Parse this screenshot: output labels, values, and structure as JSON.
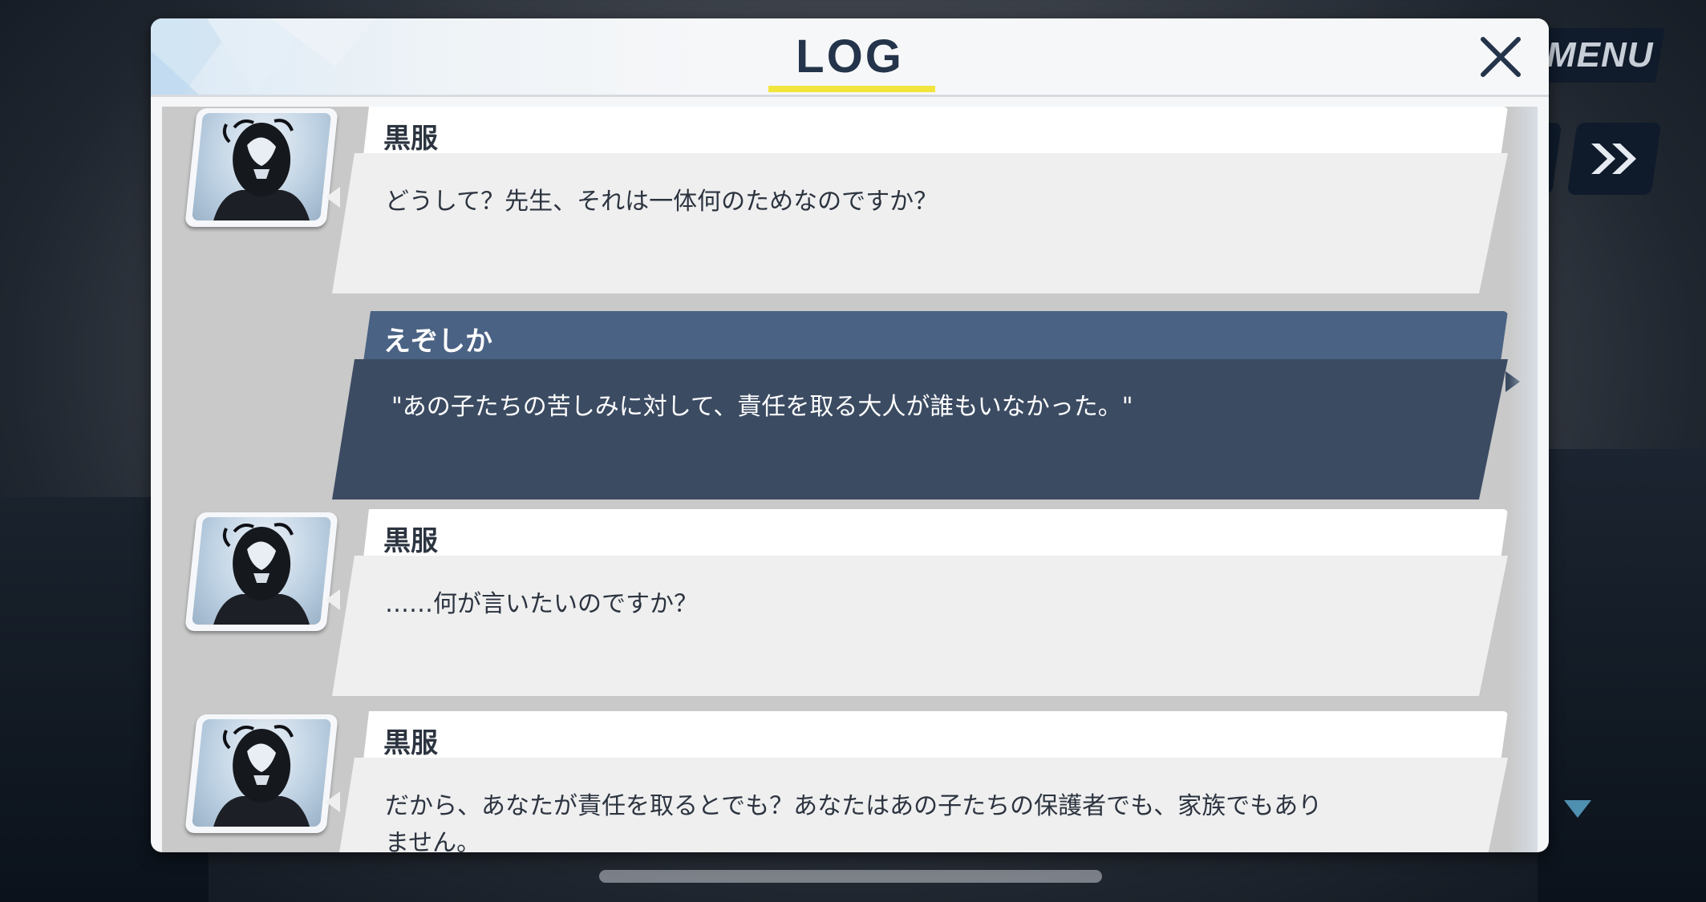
{
  "top_controls": {
    "menu_label": "MENU",
    "skip_icon": "double-chevron-right-icon",
    "scroll_indicator_icon": "triangle-down-icon"
  },
  "log_panel": {
    "title": "LOG",
    "close_icon": "close-x-icon",
    "entries": [
      {
        "speaker": "黒服",
        "text": "どうして？先生、それは一体何のためなのですか？",
        "is_player": false
      },
      {
        "speaker": "えぞしか",
        "text": "\"あの子たちの苦しみに対して、責任を取る大人が誰もいなかった。\"",
        "is_player": true
      },
      {
        "speaker": "黒服",
        "text": "……何が言いたいのですか？",
        "is_player": false
      },
      {
        "speaker": "黒服",
        "text": "だから、あなたが責任を取るとでも？あなたはあの子たちの保護者でも、家族でもありません。",
        "is_player": false
      }
    ]
  },
  "colors": {
    "title_underline": "#f2e53b",
    "player_name_bar": "#4a6284",
    "player_bubble": "#3b4b62",
    "npc_bubble": "#efefef",
    "title_text": "#24344a"
  }
}
